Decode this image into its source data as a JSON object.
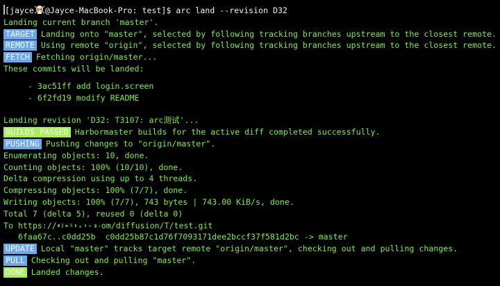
{
  "prompt": {
    "open": "[jayce",
    "host": "@Jayce-MacBook-Pro: test]$ ",
    "command": "arc land --revision D32"
  },
  "lines": {
    "l1": "Landing current branch 'master'.",
    "l2_badge": "TARGET",
    "l2": "Landing onto \"master\", selected by following tracking branches upstream to the closest remote.",
    "l3_badge": "REMOTE",
    "l3": "Using remote \"origin\", selected by following tracking branches upstream to the closest remote.",
    "l4_badge": "FETCH",
    "l4": "Fetching origin/master...",
    "l5": "These commits will be landed:",
    "c1": "  - 3ac51ff add login.screen",
    "c2": "  - 6f2fd19 modify README",
    "l6": "Landing revision 'D32: T3107: arc测试'...",
    "l7_badge": "BUILDS PASSED",
    "l7": "Harbormaster builds for the active diff completed successfully.",
    "l8_badge": "PUSHING",
    "l8": "Pushing changes to \"origin/master\".",
    "l9": "Enumerating objects: 10, done.",
    "l10": "Counting objects: 100% (10/10), done.",
    "l11": "Delta compression using up to 4 threads.",
    "l12": "Compressing objects: 100% (7/7), done.",
    "l13": "Writing objects: 100% (7/7), 743 bytes | 743.00 KiB/s, done.",
    "l14": "Total 7 (delta 5), reused 0 (delta 0)",
    "l15a": "To https://",
    "l15b": "om/diffusion/T/test.git",
    "l16": "   6faa67c..c0dd25b  c0dd25b87c1d76f7093171dee2bccf37f581d2bc -> master",
    "l17_badge": "UPDATE",
    "l17": "Local \"master\" tracks target remote \"origin/master\", checking out and pulling changes.",
    "l18_badge": "PULL",
    "l18": "Checking out and pulling \"master\".",
    "l19_badge": "DONE",
    "l19": "Landed changes."
  },
  "colors": {
    "background": "#000000",
    "text": "#7cf03f",
    "badge_blue": "#68a8f0",
    "badge_green": "#a7f05c"
  },
  "icons": {
    "prompt_icon": "skull-icon"
  }
}
